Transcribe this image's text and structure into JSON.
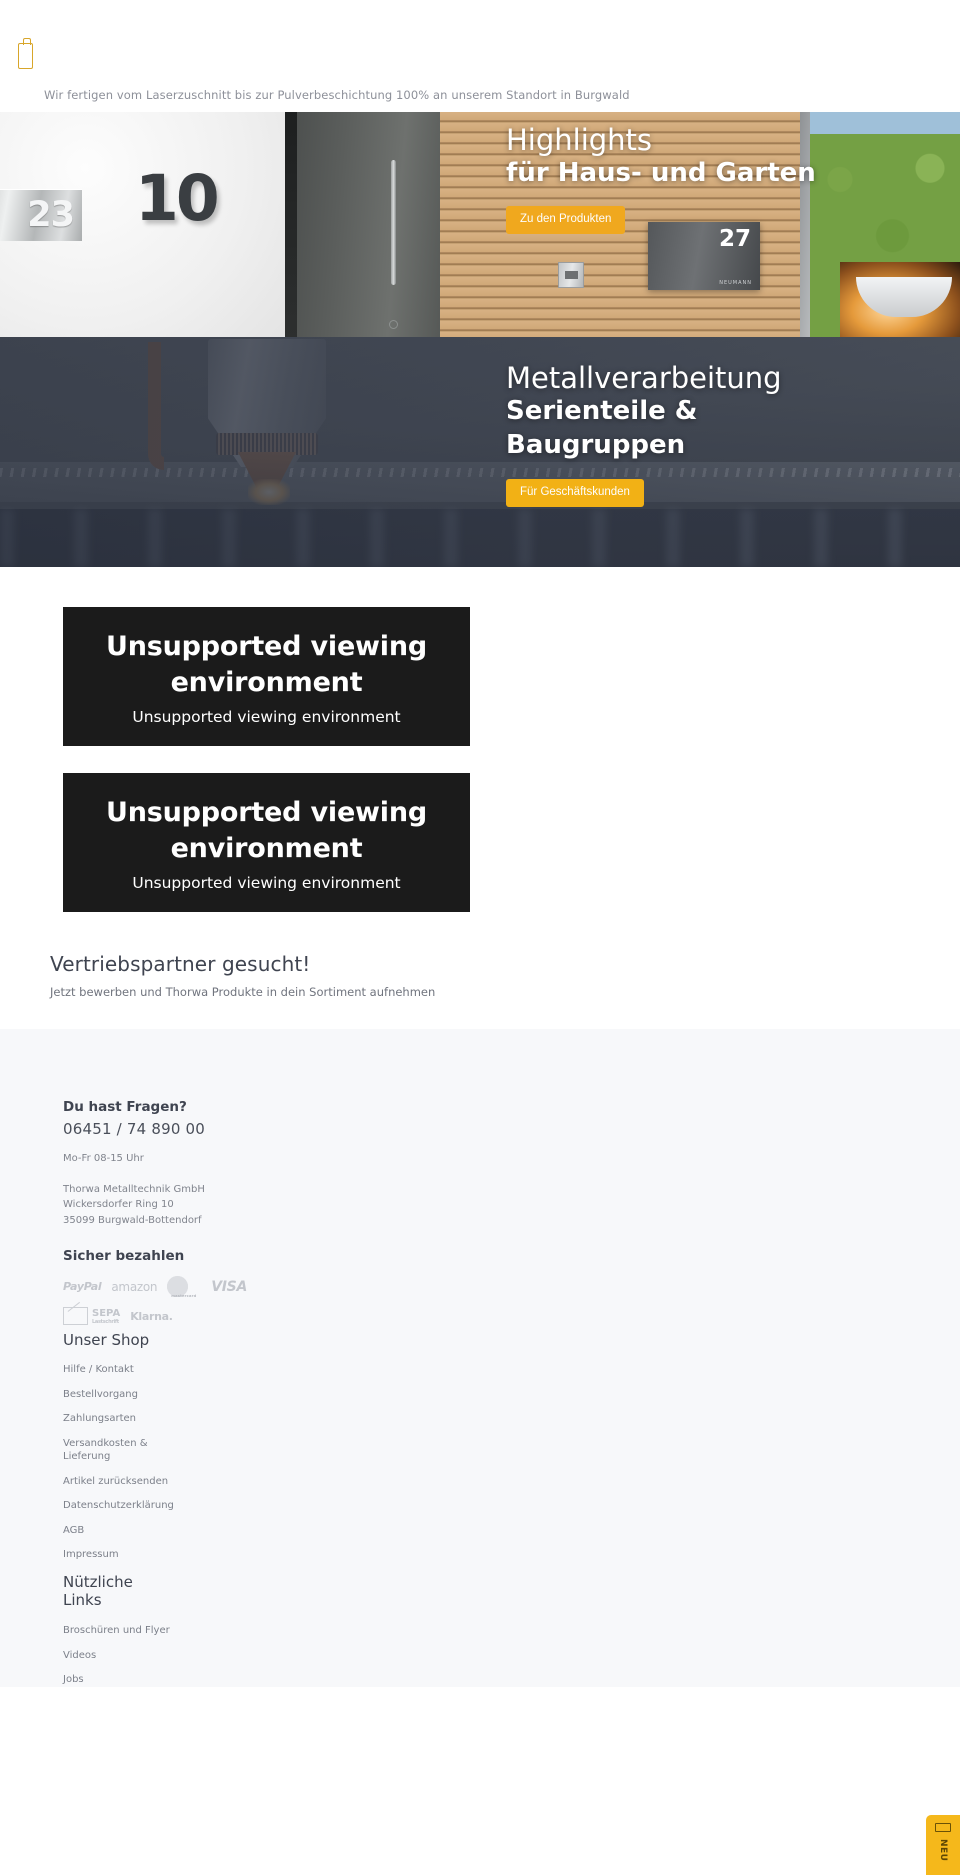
{
  "topbar": {
    "menu_icon": "menu-bar-icon",
    "tagline": "Wir fertigen vom Laserzuschnitt bis zur Pulverbeschichtung 100% an unserem Standort in Burgwald"
  },
  "heroes": [
    {
      "title": "Highlights",
      "subtitle": "für Haus- und Garten",
      "cta": "Zu den Produkten",
      "cta_color": "#f0a81e",
      "image_alt": "Hausnummern, Briefkasten und Tür an Hausfassade",
      "house_number_plate": "23",
      "house_number_wall": "10",
      "mailbox_number": "27",
      "mailbox_brand": "NEUMANN"
    },
    {
      "title": "Metallverarbeitung",
      "subtitle_line1": "Serienteile &",
      "subtitle_line2": "Baugruppen",
      "cta": "Für Geschäftskunden",
      "cta_color": "#f2b115",
      "image_alt": "Laserschneidkopf beim Schneiden von Blech"
    }
  ],
  "videos": [
    {
      "title": "Unsupported viewing environment",
      "subtitle": "Unsupported viewing environment"
    },
    {
      "title": "Unsupported viewing environment",
      "subtitle": "Unsupported viewing environment"
    }
  ],
  "partner": {
    "heading": "Vertriebspartner gesucht!",
    "text": "Jetzt bewerben und Thorwa Produkte in dein Sortiment aufnehmen"
  },
  "footer": {
    "contact": {
      "heading": "Du hast Fragen?",
      "phone": "06451 / 74 890 00",
      "hours": "Mo-Fr 08-15 Uhr",
      "company": "Thorwa Metalltechnik GmbH",
      "street": "Wickersdorfer Ring 10",
      "city": "35099 Burgwald-Bottendorf"
    },
    "payment": {
      "heading": "Sicher bezahlen",
      "methods": [
        {
          "name": "paypal-logo",
          "label": "PayPal"
        },
        {
          "name": "amazon-logo",
          "label": "amazon"
        },
        {
          "name": "mastercard-logo",
          "label": "mastercard"
        },
        {
          "name": "visa-logo",
          "label": "VISA"
        },
        {
          "name": "sepa-logo",
          "label": "SEPA",
          "sub": "Lastschrift"
        },
        {
          "name": "klarna-logo",
          "label": "Klarna."
        }
      ]
    },
    "shop": {
      "heading": "Unser Shop",
      "links": [
        "Hilfe / Kontakt",
        "Bestellvorgang",
        "Zahlungsarten",
        "Versandkosten & Lieferung",
        "Artikel zurücksenden",
        "Datenschutzerklärung",
        "AGB",
        "Impressum"
      ]
    },
    "useful": {
      "heading": "Nützliche Links",
      "links": [
        "Broschüren und Flyer",
        "Videos",
        "Jobs"
      ]
    }
  },
  "fab": {
    "icon": "card-icon",
    "label": "NEU"
  }
}
